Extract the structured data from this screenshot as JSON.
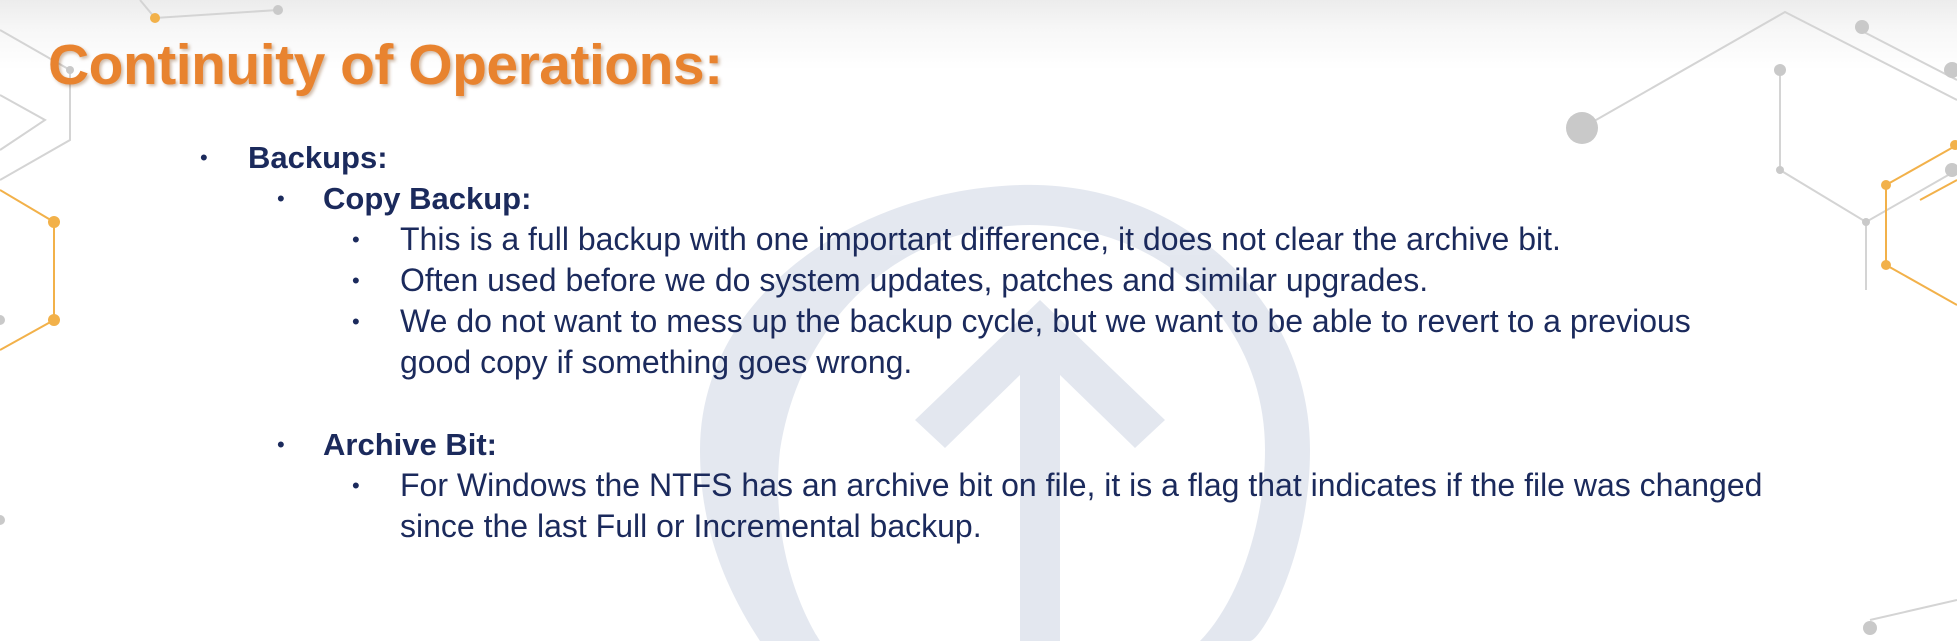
{
  "slide": {
    "title": "Continuity of Operations:",
    "colors": {
      "title": "#e8832f",
      "body_text": "#1b2a5c",
      "accent_lines": "#f2b14a",
      "network_nodes": "#c9c9c9",
      "watermark": "#dfe3ec"
    },
    "bullet_glyph": "•",
    "sections": [
      {
        "heading": "Backups:",
        "subsections": [
          {
            "heading": "Copy Backup:",
            "points": [
              {
                "line1": "This is a full backup with one important difference, it does not clear the archive bit.",
                "line2": ""
              },
              {
                "line1": "Often used before we do system updates, patches and similar upgrades.",
                "line2": ""
              },
              {
                "line1": "We do not want to mess up the backup cycle, but we want to be able to revert to a previous",
                "line2": "good copy if something goes wrong."
              }
            ]
          },
          {
            "heading": "Archive Bit:",
            "points": [
              {
                "line1": "For Windows the NTFS has an archive bit on file, it is a flag that indicates if the file was changed",
                "line2": "since the last Full or Incremental backup."
              }
            ]
          }
        ]
      }
    ],
    "decorations": {
      "background_icon": "network-nodes-graphic",
      "watermark_icon": "upward-arrow-circle-watermark"
    }
  }
}
